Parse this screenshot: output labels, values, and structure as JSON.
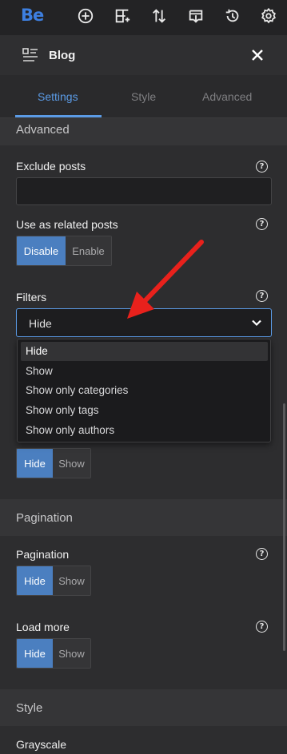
{
  "toolbar": {
    "logo": "Be",
    "icons": [
      "add-icon",
      "layout-add-icon",
      "sort-icon",
      "export-icon",
      "history-icon",
      "settings-icon"
    ]
  },
  "panel": {
    "title": "Blog",
    "tabs": [
      {
        "label": "Settings",
        "active": true
      },
      {
        "label": "Style",
        "active": false
      },
      {
        "label": "Advanced",
        "active": false
      }
    ]
  },
  "sections": {
    "advanced": {
      "title": "Advanced",
      "exclude_posts": {
        "label": "Exclude posts",
        "value": ""
      },
      "related": {
        "label": "Use as related posts",
        "options": [
          "Disable",
          "Enable"
        ],
        "selected": "Disable"
      },
      "filters": {
        "label": "Filters",
        "value": "Hide",
        "options": [
          "Hide",
          "Show",
          "Show only categories",
          "Show only tags",
          "Show only authors"
        ]
      },
      "hidden_toggle": {
        "options": [
          "Hide",
          "Show"
        ],
        "selected": "Hide"
      }
    },
    "pagination": {
      "title": "Pagination",
      "pagination": {
        "label": "Pagination",
        "options": [
          "Hide",
          "Show"
        ],
        "selected": "Hide"
      },
      "load_more": {
        "label": "Load more",
        "options": [
          "Hide",
          "Show"
        ],
        "selected": "Hide"
      }
    },
    "style": {
      "title": "Style",
      "grayscale": {
        "label": "Grayscale"
      }
    }
  },
  "help_glyph": "?",
  "colors": {
    "accent": "#5b9be6",
    "toggle_on": "#4b7fc0",
    "arrow": "#e8211c"
  }
}
